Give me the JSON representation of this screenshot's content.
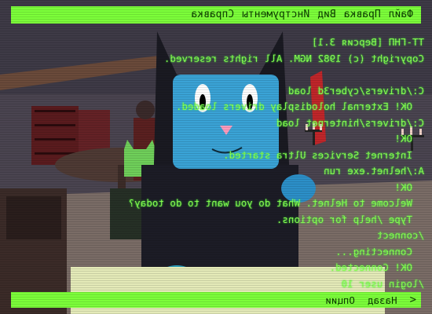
{
  "menu": {
    "items": [
      "Файл",
      "Правка",
      "Вид",
      "Инструменты",
      "Справка"
    ]
  },
  "terminal": {
    "lines": [
      "TT-ГНП [Версия 3.1]",
      "Copyright (c) 1982 NGM. All rights reserved.",
      "",
      "C:/drivers/cyber3d load",
      "  OK! External holodisplay drivers loaded.",
      "C:/drivers/hinternet load",
      "  OK!",
      "  Internet Services Ultra started.",
      "A:/helnet.exe run",
      "  OK!",
      "  Welcome to Helnet. What do you want to do today?",
      "  Type /help for options.",
      "/connect",
      "  Connecting...",
      "  OK! Connected.",
      "/login user 10"
    ]
  },
  "status": {
    "back_label": "Назад",
    "options_label": "Опции"
  }
}
